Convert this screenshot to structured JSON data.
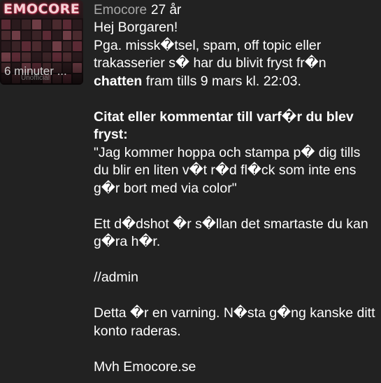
{
  "avatar": {
    "logo_text": "EMOCORE",
    "watermark": "Unofficial",
    "time": "6 minuter ..."
  },
  "header": {
    "username": "Emocore",
    "age": "27 år"
  },
  "message": {
    "greeting": "Hej Borgaren!",
    "line1": "Pga. missk�tsel, spam, off topic eller trakasserier s� har du blivit fryst fr�n",
    "bold_word": "chatten",
    "line1_cont": "fram tills 9 mars kl. 22:03.",
    "quote_heading": "Citat eller kommentar till varf�r du blev fryst:",
    "quote": "\"Jag kommer hoppa och stampa p� dig tills du blir en liten v�t r�d fl�ck som inte ens g�r bort med via color\"",
    "advice": "Ett d�dshot �r s�llan det smartaste du kan g�ra h�r.",
    "signature_admin": "//admin",
    "warning": "Detta �r en varning. N�sta g�ng kanske ditt konto raderas.",
    "closing": "Mvh Emocore.se"
  }
}
